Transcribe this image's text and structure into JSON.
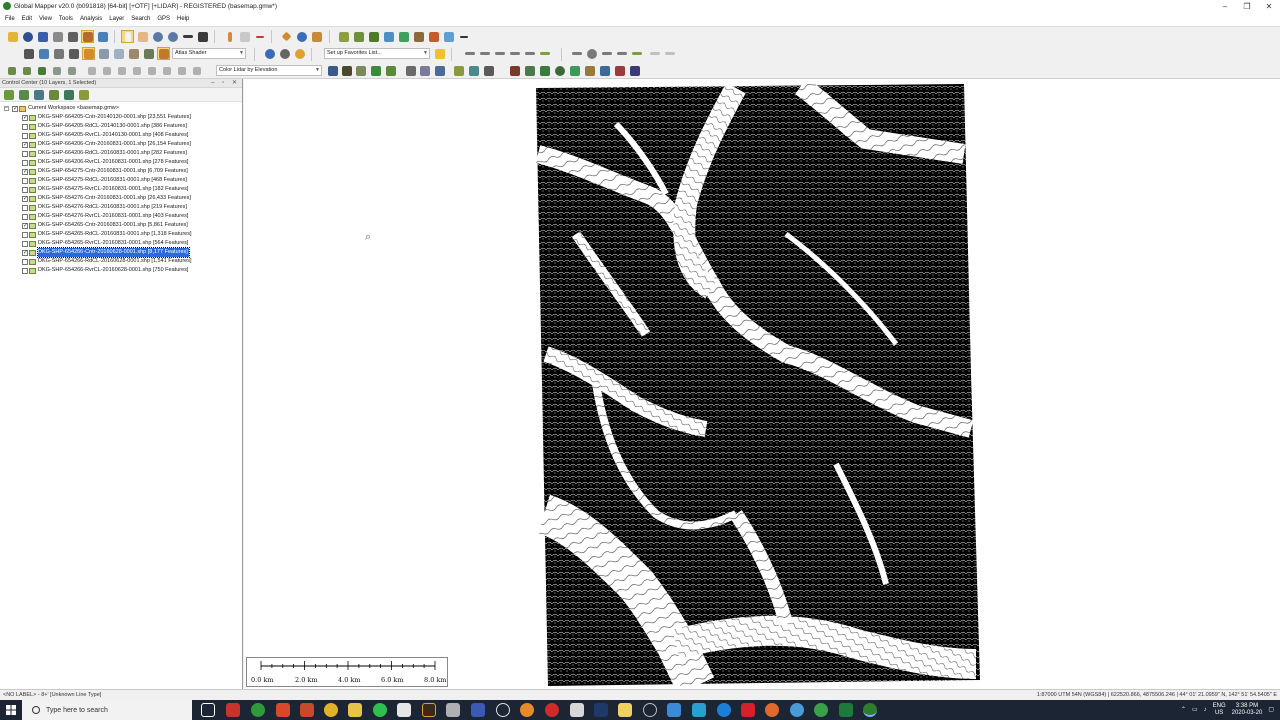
{
  "window": {
    "title": "Global Mapper v20.0 (b091818) [64-bit] [+OTF] [+LIDAR] - REGISTERED (basemap.gmw*)",
    "controls": [
      "–",
      "❐",
      "✕"
    ]
  },
  "menu": [
    "File",
    "Edit",
    "View",
    "Tools",
    "Analysis",
    "Layer",
    "Search",
    "GPS",
    "Help"
  ],
  "toolbar": {
    "shader_select": "Atlas Shader",
    "favorites_select": "Set up Favorites List...",
    "lidar_color_select": "Color Lidar by Elevation"
  },
  "control_center": {
    "header": "Control Center (10 Layers, 1 Selected)",
    "header_buttons": "– ▫ ✕",
    "workspace_label": "Current Workspace <basemap.gmw>",
    "layers": [
      {
        "label": "DKG-SHP-664205-Cntr-20140130-0001.shp [23,551 Features]",
        "checked": true,
        "selected": false
      },
      {
        "label": "DKG-SHP-664205-RdCL-20140130-0001.shp [386 Features]",
        "checked": false,
        "selected": false
      },
      {
        "label": "DKG-SHP-664205-RvrCL-20140130-0001.shp [408 Features]",
        "checked": false,
        "selected": false
      },
      {
        "label": "DKG-SHP-664206-Cntr-20160831-0001.shp [26,154 Features]",
        "checked": true,
        "selected": false
      },
      {
        "label": "DKG-SHP-664206-RdCL-20160831-0001.shp [282 Features]",
        "checked": false,
        "selected": false
      },
      {
        "label": "DKG-SHP-664206-RvrCL-20160831-0001.shp [278 Features]",
        "checked": false,
        "selected": false
      },
      {
        "label": "DKG-SHP-654275-Cntr-20160831-0001.shp [6,709 Features]",
        "checked": true,
        "selected": false
      },
      {
        "label": "DKG-SHP-654275-RdCL-20160831-0001.shp [468 Features]",
        "checked": false,
        "selected": false
      },
      {
        "label": "DKG-SHP-654275-RvrCL-20160831-0001.shp [182 Features]",
        "checked": false,
        "selected": false
      },
      {
        "label": "DKG-SHP-654276-Cntr-20160831-0001.shp [26,433 Features]",
        "checked": true,
        "selected": false
      },
      {
        "label": "DKG-SHP-654276-RdCL-20160831-0001.shp [219 Features]",
        "checked": false,
        "selected": false
      },
      {
        "label": "DKG-SHP-654276-RvrCL-20160831-0001.shp [403 Features]",
        "checked": false,
        "selected": false
      },
      {
        "label": "DKG-SHP-654265-Cntr-20160831-0001.shp [5,861 Features]",
        "checked": true,
        "selected": false
      },
      {
        "label": "DKG-SHP-654265-RdCL-20160831-0001.shp [1,318 Features]",
        "checked": false,
        "selected": false
      },
      {
        "label": "DKG-SHP-654265-RvrCL-20160831-0001.shp [564 Features]",
        "checked": false,
        "selected": false
      },
      {
        "label": "DKG-SHP-654266-Cntr-20160628-0001.shp [8,177 Features]",
        "checked": true,
        "selected": true
      },
      {
        "label": "DKG-SHP-654266-RdCL-20160628-0001.shp [1,541 Features]",
        "checked": false,
        "selected": false
      },
      {
        "label": "DKG-SHP-654266-RvrCL-20160628-0001.shp [750 Features]",
        "checked": false,
        "selected": false
      }
    ]
  },
  "scalebar": {
    "labels": [
      "0.0 km",
      "2.0 km",
      "4.0 km",
      "6.0 km",
      "8.0 km"
    ]
  },
  "status": {
    "left": "<NO LABEL> - 8+' [Unknown Line Type]",
    "right": "1:87000 UTM 54N (WGS84) | 622520.866, 4875506.246 | 44° 01' 21.0959\" N, 142° 51' 54.5405\" E"
  },
  "taskbar": {
    "search_placeholder": "Type here to search",
    "language_top": "ENG",
    "language_bottom": "US",
    "time": "3:38 PM",
    "date": "2020-03-20"
  },
  "colors": {
    "selection": "#2a6ad9",
    "taskbar": "#1c2533",
    "map_background": "#ffffff",
    "terrain_dark": "#000000"
  }
}
